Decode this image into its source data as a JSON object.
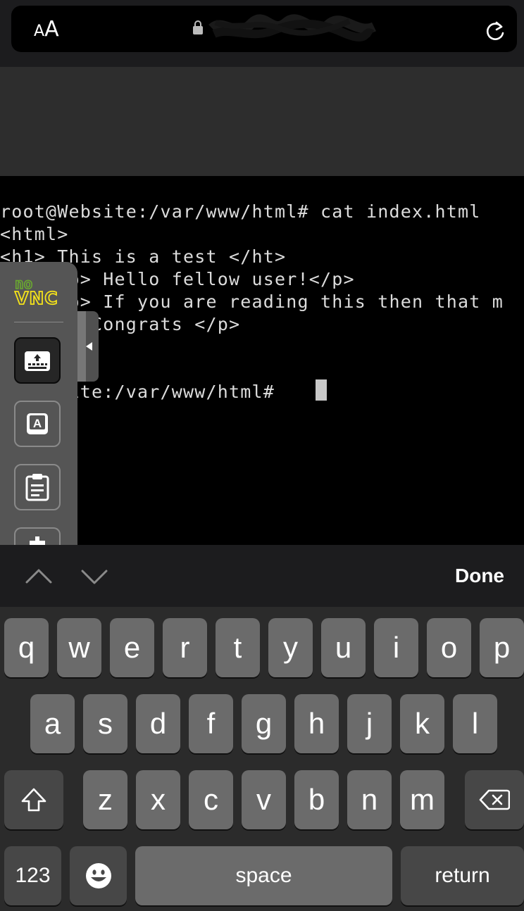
{
  "browser": {
    "text_size_small": "A",
    "text_size_large": "A",
    "url": "",
    "icons": [
      "lock-icon",
      "reload-icon"
    ]
  },
  "terminal": {
    "lines": [
      "root@Website:/var/www/html# cat index.html",
      "<html>",
      "<h1> This is a test </ht>",
      "     <p> Hello fellow user!</p>",
      "     <p> If you are reading this then that m",
      "    <p> Congrats </p>",
      "",
      "",
      "    bsite:/var/www/html# "
    ]
  },
  "novnc": {
    "logo_top": "no",
    "logo_bottom": "VNC",
    "colors": {
      "logo_green": "#6aa830",
      "logo_yellow": "#f4e21b"
    },
    "buttons": [
      "keyboard-icon",
      "extra-keys-icon",
      "clipboard-icon",
      "settings-icon"
    ]
  },
  "accessory": {
    "done_label": "Done",
    "icons": [
      "chevron-up-icon",
      "chevron-down-icon"
    ]
  },
  "keyboard": {
    "row1": [
      "q",
      "w",
      "e",
      "r",
      "t",
      "y",
      "u",
      "i",
      "o",
      "p"
    ],
    "row2": [
      "a",
      "s",
      "d",
      "f",
      "g",
      "h",
      "j",
      "k",
      "l"
    ],
    "row3": [
      "z",
      "x",
      "c",
      "v",
      "b",
      "n",
      "m"
    ],
    "numbers_label": "123",
    "space_label": "space",
    "return_label": "return",
    "icons": [
      "shift-icon",
      "backspace-icon",
      "emoji-icon"
    ]
  }
}
